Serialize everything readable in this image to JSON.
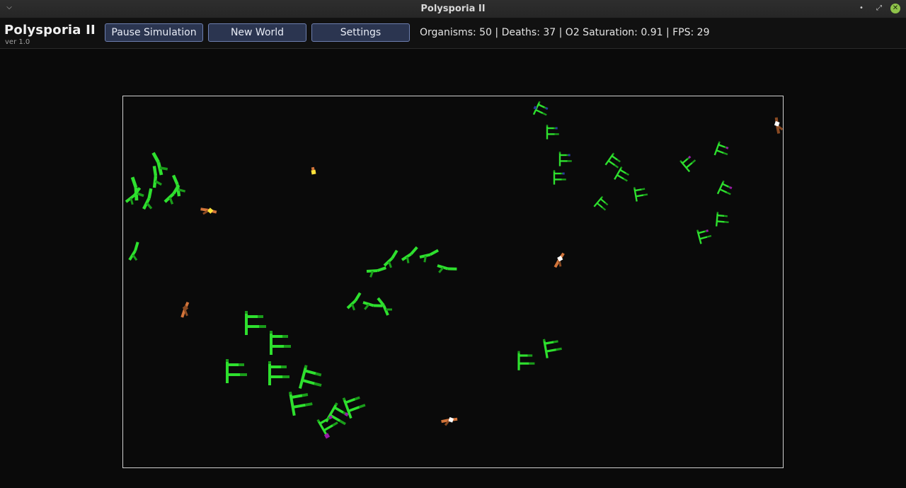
{
  "window": {
    "title": "Polysporia II",
    "menu_icon": "chevron-down-icon",
    "controls": [
      "minimize-icon",
      "maximize-icon",
      "close-icon"
    ]
  },
  "app": {
    "name": "Polysporia II",
    "version": "ver 1.0"
  },
  "toolbar": {
    "pause_label": "Pause Simulation",
    "new_world_label": "New World",
    "settings_label": "Settings"
  },
  "stats": {
    "text": "Organisms: 50 | Deaths: 37 | O2 Saturation: 0.91 | FPS: 29"
  },
  "colors": {
    "background": "#0a0a0a",
    "world_border": "#d0d0d0",
    "button_bg": "#2b3550",
    "button_border": "#6d7fb0",
    "plant_green": "#2ee02e",
    "plant_dark_green": "#1a9c1a",
    "node_blue": "#2a3aa0",
    "node_purple": "#9a1aa8",
    "herbivore_orange": "#d2743a",
    "herbivore_yellow": "#ffe23a",
    "node_white": "#ffffff",
    "herbivore_brown": "#8a4a22"
  }
}
